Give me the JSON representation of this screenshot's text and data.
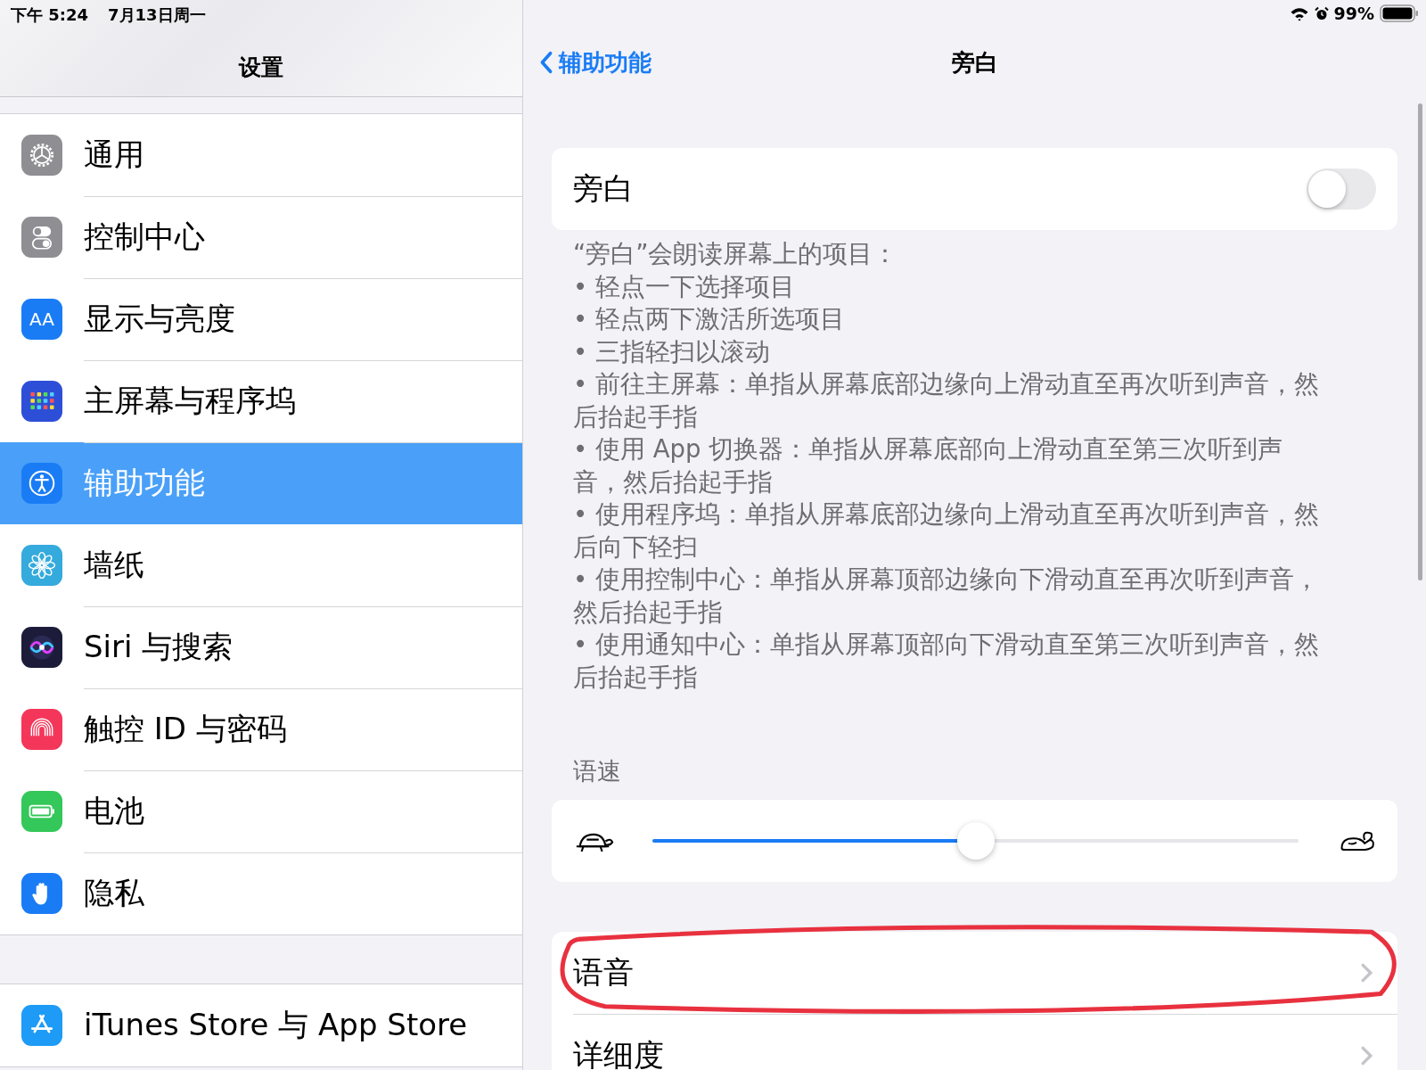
{
  "status_bar": {
    "time": "下午 5:24",
    "date": "7月13日周一",
    "battery_text": "99%"
  },
  "sidebar": {
    "title": "设置",
    "groups": [
      [
        {
          "label": "通用",
          "kind": "gear",
          "color": "#8e8e93",
          "selected": false
        },
        {
          "label": "控制中心",
          "kind": "toggles",
          "color": "#8e8e93",
          "selected": false
        },
        {
          "label": "显示与亮度",
          "kind": "text",
          "icon_text": "AA",
          "color": "#1a7cf5",
          "selected": false
        },
        {
          "label": "主屏幕与程序坞",
          "kind": "grid",
          "color": "#2d4fd8",
          "selected": false
        },
        {
          "label": "辅助功能",
          "kind": "accessibility",
          "color": "#1a7cf5",
          "selected": true
        },
        {
          "label": "墙纸",
          "kind": "flower",
          "color": "#35aadc",
          "selected": false
        },
        {
          "label": "Siri 与搜索",
          "kind": "siri",
          "color": "#1c1c3a",
          "selected": false
        },
        {
          "label": "触控 ID 与密码",
          "kind": "fingerprint",
          "color": "#f4365a",
          "selected": false
        },
        {
          "label": "电池",
          "kind": "battery",
          "color": "#34c759",
          "selected": false
        },
        {
          "label": "隐私",
          "kind": "hand",
          "color": "#1a7cf5",
          "selected": false
        }
      ],
      [
        {
          "label": "iTunes Store 与 App Store",
          "kind": "appstore",
          "color": "#1d9bf6",
          "selected": false
        }
      ]
    ]
  },
  "detail": {
    "back": "辅助功能",
    "title": "旁白",
    "switch": {
      "label": "旁白",
      "on": false
    },
    "description": {
      "intro": "“旁白”会朗读屏幕上的项目：",
      "items": [
        "• 轻点一下选择项目",
        "• 轻点两下激活所选项目",
        "• 三指轻扫以滚动",
        "• 前往主屏幕：单指从屏幕底部边缘向上滑动直至再次听到声音，然后抬起手指",
        "• 使用 App 切换器：单指从屏幕底部向上滑动直至第三次听到声音，然后抬起手指",
        "• 使用程序坞：单指从屏幕底部边缘向上滑动直至再次听到声音，然后向下轻扫",
        "• 使用控制中心：单指从屏幕顶部边缘向下滑动直至再次听到声音，然后抬起手指",
        "• 使用通知中心：单指从屏幕顶部向下滑动直至第三次听到声音，然后抬起手指"
      ]
    },
    "speed": {
      "header": "语速",
      "level": 0.5
    },
    "rows": [
      {
        "label": "语音",
        "circled": true
      },
      {
        "label": "详细度",
        "circled": false
      }
    ]
  }
}
